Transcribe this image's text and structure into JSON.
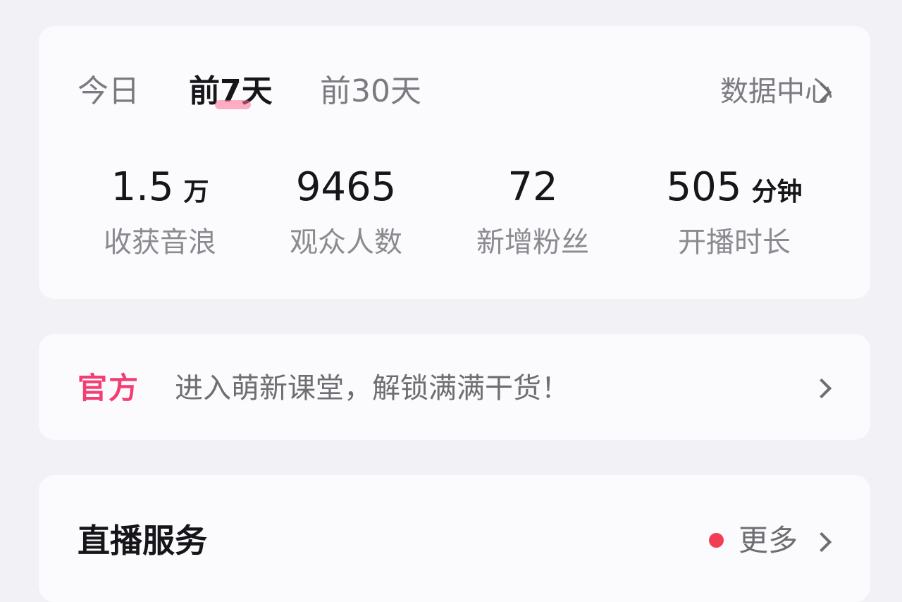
{
  "period_tabs": [
    {
      "label": "今日",
      "active": false
    },
    {
      "label": "前7天",
      "active": true
    },
    {
      "label": "前30天",
      "active": false
    }
  ],
  "data_center_link": "数据中心",
  "stats": [
    {
      "value": "1.5",
      "unit": "万",
      "label": "收获音浪"
    },
    {
      "value": "9465",
      "unit": "",
      "label": "观众人数"
    },
    {
      "value": "72",
      "unit": "",
      "label": "新增粉丝"
    },
    {
      "value": "505",
      "unit": "分钟",
      "label": "开播时长"
    }
  ],
  "banner": {
    "tag": "官方",
    "text": "进入萌新课堂，解锁满满干货！"
  },
  "live_service": {
    "title": "直播服务",
    "more_label": "更多"
  },
  "colors": {
    "accent_pink": "#f33d73",
    "notification_dot": "#f33d55",
    "page_bg": "#f1f1f6",
    "card_bg": "#fbfbfd"
  },
  "icons": [
    "chevron-right-icon",
    "notification-dot-icon"
  ]
}
